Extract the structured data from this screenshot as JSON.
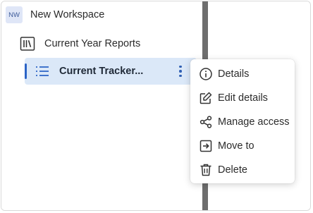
{
  "workspace": {
    "badge": "NW",
    "name": "New Workspace"
  },
  "folder": {
    "icon": "library-icon",
    "label": "Current Year Reports"
  },
  "tracker": {
    "icon": "list-icon",
    "label": "Current Tracker..."
  },
  "context_menu": {
    "items": [
      {
        "icon": "info-icon",
        "label": "Details"
      },
      {
        "icon": "edit-icon",
        "label": "Edit details"
      },
      {
        "icon": "share-icon",
        "label": "Manage access"
      },
      {
        "icon": "move-icon",
        "label": "Move to"
      },
      {
        "icon": "trash-icon",
        "label": "Delete"
      }
    ]
  },
  "colors": {
    "selected_row": "#dbe8f8",
    "accent": "#2b63c6",
    "splitter": "#6e6e6e",
    "badge_bg": "#dfe6f7"
  }
}
